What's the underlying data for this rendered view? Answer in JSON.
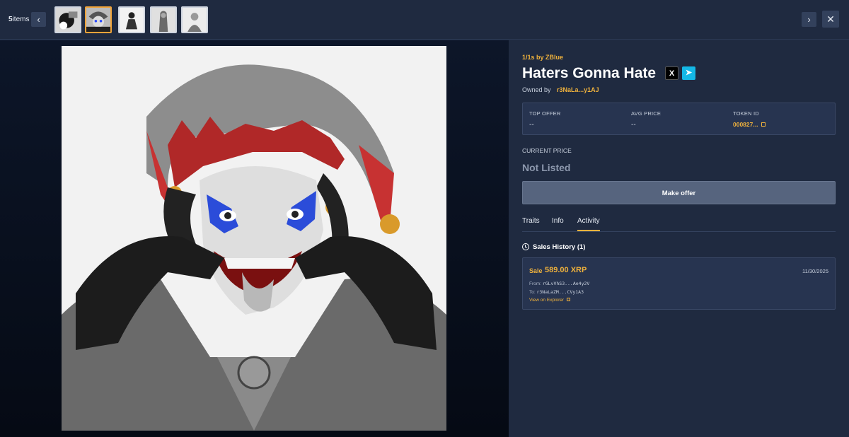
{
  "header": {
    "item_count_number": "5",
    "item_count_label": "items",
    "prev_label": "‹",
    "next_label": "›",
    "close_label": "✕",
    "thumbnails": [
      "thumb-1",
      "thumb-2",
      "thumb-3",
      "thumb-4",
      "thumb-5"
    ],
    "active_thumbnail": 2
  },
  "nft": {
    "collection": "1/1s by ZBlue",
    "title": "Haters Gonna Hate",
    "owner_label": "Owned by",
    "owner_address": "r3NaLa...y1AJ",
    "social": {
      "x_label": "X",
      "telegram_label": "➤"
    }
  },
  "stats": {
    "top_offer_label": "TOP OFFER",
    "top_offer_value": "--",
    "avg_price_label": "AVG PRICE",
    "avg_price_value": "--",
    "token_id_label": "TOKEN ID",
    "token_id_value": "000827..."
  },
  "price": {
    "current_label": "CURRENT PRICE",
    "current_value": "Not Listed",
    "offer_button": "Make offer"
  },
  "tabs": [
    "Traits",
    "Info",
    "Activity"
  ],
  "active_tab": "Activity",
  "sales": {
    "heading": "Sales History (1)",
    "items": [
      {
        "kind": "Sale",
        "amount": "589.00 XRP",
        "date": "11/30/2025",
        "from_label": "From:",
        "from": "rGLvVhS3...Ae4y2V",
        "to_label": "To:",
        "to": "r3NaLaZM...CVy1A3",
        "explorer_link": "View on Explorer"
      }
    ]
  },
  "colors": {
    "accent": "#f0b23c",
    "panel": "#1f2a40",
    "card": "#273450"
  }
}
